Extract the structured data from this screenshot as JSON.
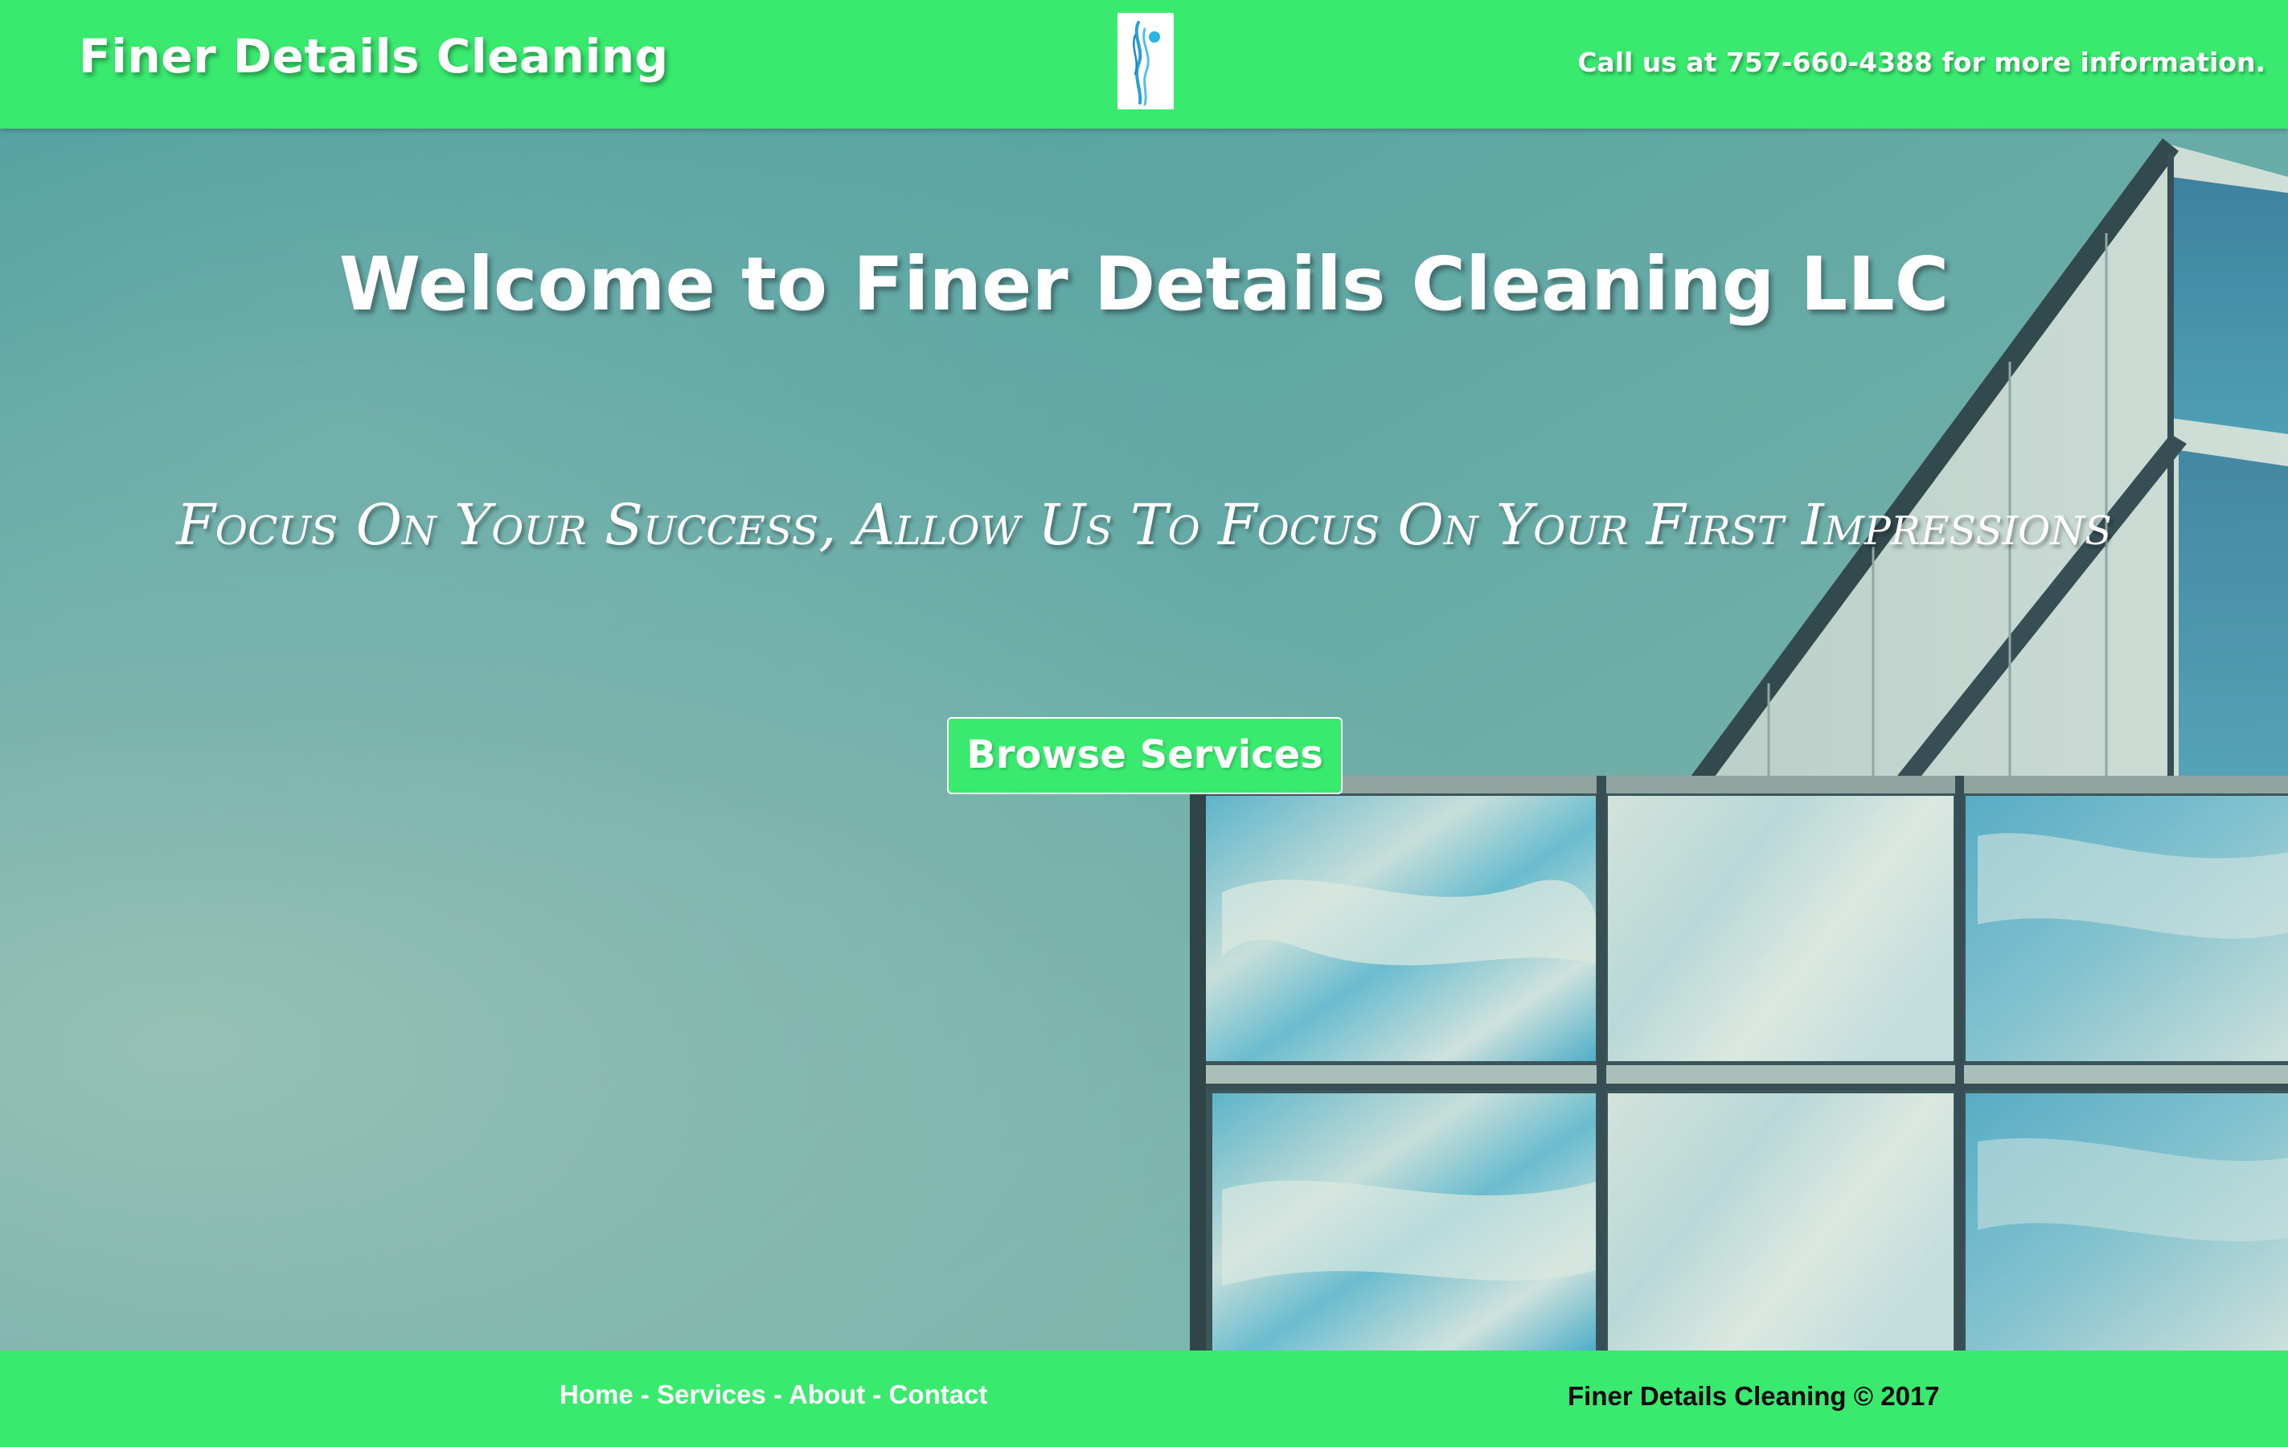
{
  "header": {
    "brand": "Finer Details Cleaning",
    "phone_text": "Call us at 757-660-4388 for more information."
  },
  "hero": {
    "title": "Welcome to Finer Details Cleaning LLC",
    "tagline": "Focus On Your Success, Allow Us To Focus On Your First Impressions",
    "button_label": "Browse Services"
  },
  "footer": {
    "nav": [
      {
        "label": "Home"
      },
      {
        "label": "Services"
      },
      {
        "label": "About"
      },
      {
        "label": "Contact"
      }
    ],
    "separator": "-",
    "copyright": "Finer Details Cleaning © 2017"
  },
  "colors": {
    "brand_green": "#39ea6f",
    "text_white": "#ffffff",
    "sky_teal": "#5fa6a5"
  },
  "icons": {
    "logo": "swirl-figure-logo"
  }
}
